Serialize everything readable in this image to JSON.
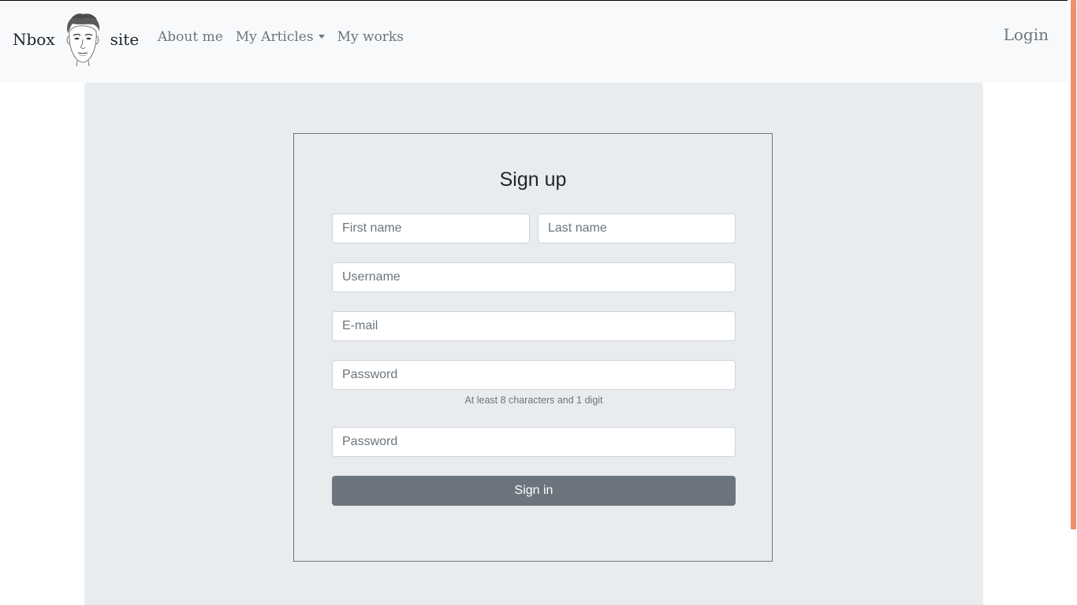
{
  "navbar": {
    "brand_left": "Nbox",
    "brand_right": "site",
    "links": [
      {
        "label": "About me"
      },
      {
        "label": "My Articles"
      },
      {
        "label": "My works"
      }
    ],
    "login_label": "Login"
  },
  "form": {
    "title": "Sign up",
    "first_name": {
      "placeholder": "First name",
      "value": ""
    },
    "last_name": {
      "placeholder": "Last name",
      "value": ""
    },
    "username": {
      "placeholder": "Username",
      "value": ""
    },
    "email": {
      "placeholder": "E-mail",
      "value": ""
    },
    "password": {
      "placeholder": "Password",
      "value": ""
    },
    "password_hint": "At least 8 characters and 1 digit",
    "password_confirm": {
      "placeholder": "Password",
      "value": ""
    },
    "submit_label": "Sign in"
  },
  "colors": {
    "navbar_bg": "#f8f9fa",
    "main_bg": "#e9ecef",
    "button_bg": "#6c757d",
    "scrollbar_thumb": "#f0906a"
  }
}
